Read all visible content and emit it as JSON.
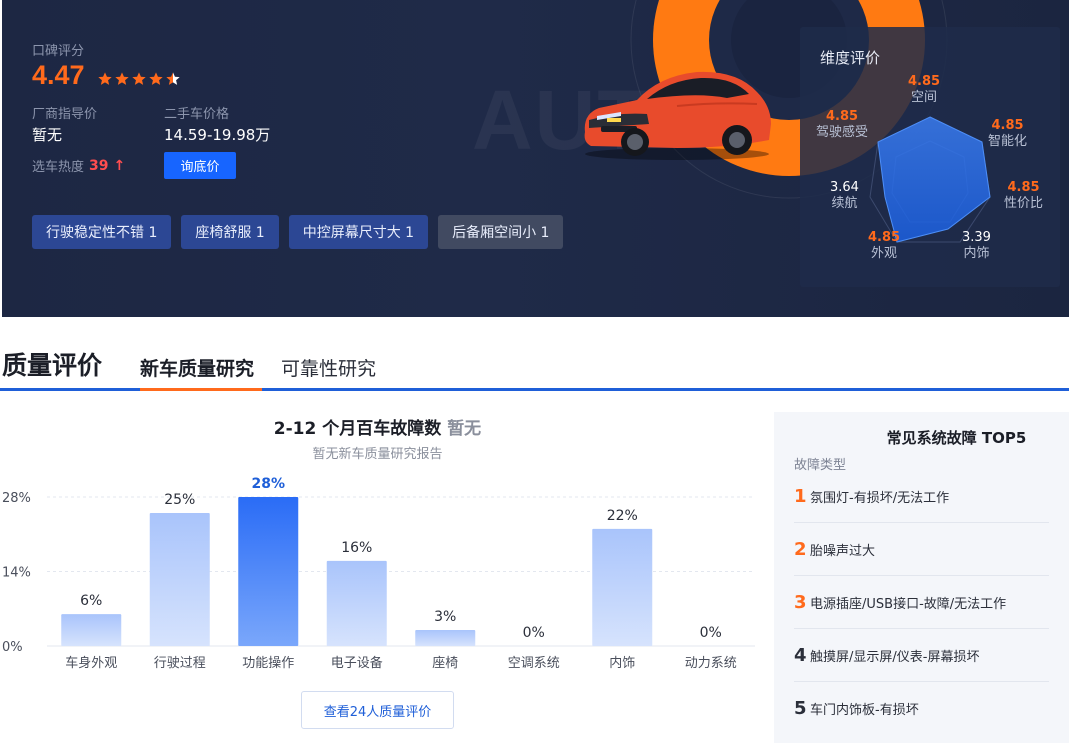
{
  "hero": {
    "rating_label": "口碑评分",
    "rating_value": "4.47",
    "stars_filled": 4.5,
    "guide_price_label": "厂商指导价",
    "guide_price_value": "暂无",
    "used_price_label": "二手车价格",
    "used_price_value": "14.59-19.98万",
    "heat_label": "选车热度",
    "heat_value": "39",
    "heat_arrow": "↑",
    "inquire_button": "询底价",
    "watermark": "AUT",
    "tags": [
      {
        "label": "行驶稳定性不错 1",
        "tone": "positive"
      },
      {
        "label": "座椅舒服 1",
        "tone": "positive"
      },
      {
        "label": "中控屏幕尺寸大 1",
        "tone": "positive"
      },
      {
        "label": "后备厢空间小 1",
        "tone": "negative"
      }
    ],
    "colors": {
      "accent": "#ff6a1c",
      "primary": "#1765ff",
      "bg": "#1d2743"
    }
  },
  "dimensions": {
    "title": "维度评价",
    "items": [
      {
        "key": "space",
        "name": "空间",
        "score": "4.85",
        "high": true
      },
      {
        "key": "smart",
        "name": "智能化",
        "score": "4.85",
        "high": true
      },
      {
        "key": "value",
        "name": "性价比",
        "score": "4.85",
        "high": true
      },
      {
        "key": "interior",
        "name": "内饰",
        "score": "3.39",
        "high": false
      },
      {
        "key": "exterior",
        "name": "外观",
        "score": "4.85",
        "high": true
      },
      {
        "key": "range",
        "name": "续航",
        "score": "3.64",
        "high": false
      },
      {
        "key": "driving",
        "name": "驾驶感受",
        "score": "4.85",
        "high": true
      }
    ]
  },
  "quality": {
    "title": "质量评价",
    "tabs": [
      {
        "label": "新车质量研究",
        "active": true
      },
      {
        "label": "可靠性研究",
        "active": false
      }
    ],
    "chart_title_main": "2-12 个月百车故障数",
    "chart_title_value": "暂无",
    "chart_subtitle": "暂无新车质量研究报告",
    "more_button": "查看24人质量评价"
  },
  "chart_data": {
    "type": "bar",
    "categories": [
      "车身外观",
      "行驶过程",
      "功能操作",
      "电子设备",
      "座椅",
      "空调系统",
      "内饰",
      "动力系统"
    ],
    "values": [
      6,
      25,
      28,
      16,
      3,
      0,
      22,
      0
    ],
    "value_labels": [
      "6%",
      "25%",
      "28%",
      "16%",
      "3%",
      "0%",
      "22%",
      "0%"
    ],
    "highlight_index": 2,
    "yticks": [
      0,
      14,
      28
    ],
    "ytick_labels": [
      "0%",
      "14%",
      "28%"
    ],
    "ylim": [
      0,
      28
    ],
    "grid": true,
    "colors": {
      "bar": "#a9c4fb",
      "highlight": "#2a6cf6",
      "highlight_label": "#1f5fd8"
    }
  },
  "top5": {
    "title": "常见系统故障 TOP5",
    "subtitle": "故障类型",
    "items": [
      {
        "rank": "1",
        "text": "氛围灯-有损坏/无法工作",
        "hot": true
      },
      {
        "rank": "2",
        "text": "胎噪声过大",
        "hot": true
      },
      {
        "rank": "3",
        "text": "电源插座/USB接口-故障/无法工作",
        "hot": true
      },
      {
        "rank": "4",
        "text": "触摸屏/显示屏/仪表-屏幕损坏",
        "hot": false
      },
      {
        "rank": "5",
        "text": "车门内饰板-有损坏",
        "hot": false
      }
    ]
  }
}
